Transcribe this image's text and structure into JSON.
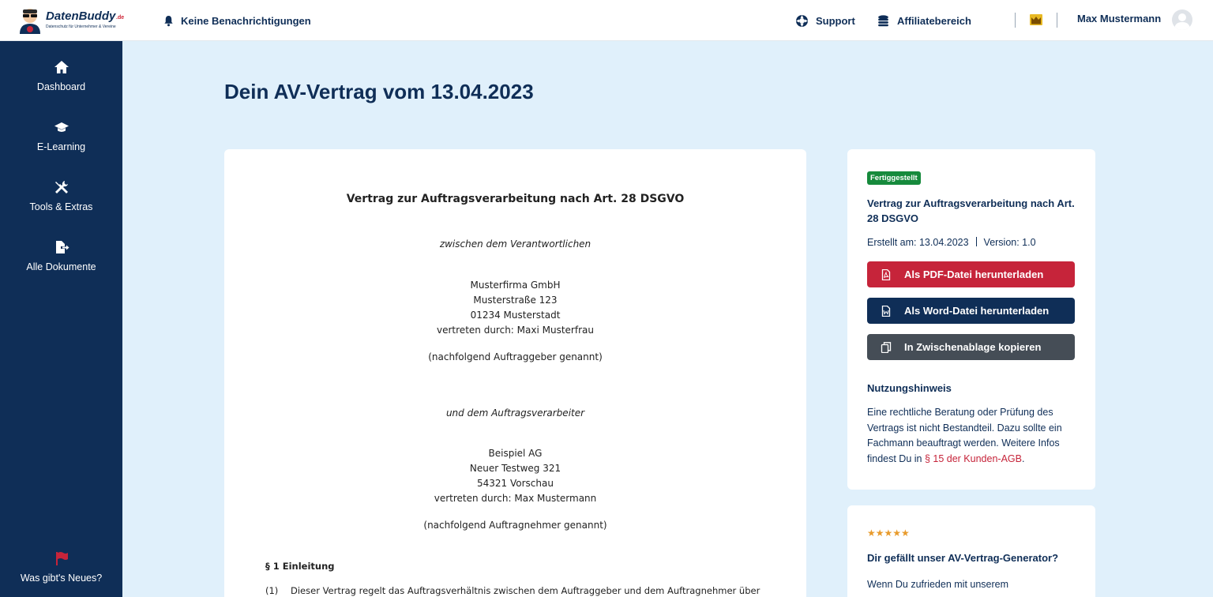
{
  "header": {
    "logo": {
      "name": "DatenBuddy",
      "tld": ".de",
      "tagline": "Datenschutz für Unternehmer & Vereine"
    },
    "notifications": "Keine Benachrichtigungen",
    "support": "Support",
    "affiliate": "Affiliatebereich",
    "user_name": "Max Mustermann"
  },
  "sidebar": {
    "items": [
      {
        "label": "Dashboard",
        "icon": "home-icon"
      },
      {
        "label": "E-Learning",
        "icon": "graduation-cap-icon"
      },
      {
        "label": "Tools & Extras",
        "icon": "tools-icon"
      },
      {
        "label": "Alle Dokumente",
        "icon": "file-export-icon"
      }
    ],
    "news": {
      "label": "Was gibt's Neues?",
      "icon": "flag-icon"
    }
  },
  "main": {
    "title": "Dein AV-Vertrag vom 13.04.2023",
    "document": {
      "title": "Vertrag zur Auftragsverarbeitung nach Art. 28 DSGVO",
      "between": "zwischen dem Verantwortlichen",
      "client": {
        "company": "Musterfirma GmbH",
        "street": "Musterstraße 123",
        "city": "01234 Musterstadt",
        "rep": "vertreten durch: Maxi Musterfrau",
        "note": "(nachfolgend Auftraggeber genannt)"
      },
      "and": "und dem Auftragsverarbeiter",
      "contractor": {
        "company": "Beispiel AG",
        "street": "Neuer Testweg 321",
        "city": "54321 Vorschau",
        "rep": "vertreten durch: Max Mustermann",
        "note": "(nachfolgend Auftragnehmer genannt)"
      },
      "section1_heading": "§ 1 Einleitung",
      "para1_num": "(1)",
      "para1_text": "Dieser Vertrag regelt das Auftragsverhältnis zwischen dem Auftraggeber und dem Auftragnehmer über"
    },
    "info": {
      "status": "Fertiggestellt",
      "title": "Vertrag zur Auftragsverarbeitung nach Art. 28 DSGVO",
      "created": "Erstellt am: 13.04.2023",
      "version": "Version: 1.0",
      "btn_pdf": "Als PDF-Datei herunterladen",
      "btn_word": "Als Word-Datei herunterladen",
      "btn_copy": "In Zwischenablage kopieren",
      "hint_heading": "Nutzungshinweis",
      "hint_text": "Eine rechtliche Beratung oder Prüfung des Vertrags ist nicht Bestandteil. Dazu sollte ein Fachmann beauftragt werden. Weitere Infos findest Du in ",
      "hint_link": "§ 15 der Kunden-AGB",
      "hint_end": "."
    },
    "rating": {
      "stars": "★★★★★",
      "stars_count": 5,
      "heading": "Dir gefällt unser AV-Vertrag-Generator?",
      "text": "Wenn Du zufrieden mit unserem"
    }
  },
  "colors": {
    "navy": "#0f2e57",
    "background": "#e0f0fb",
    "red": "#c6243a",
    "green": "#168a3c",
    "gray": "#454d56",
    "star": "#e89b2c"
  }
}
